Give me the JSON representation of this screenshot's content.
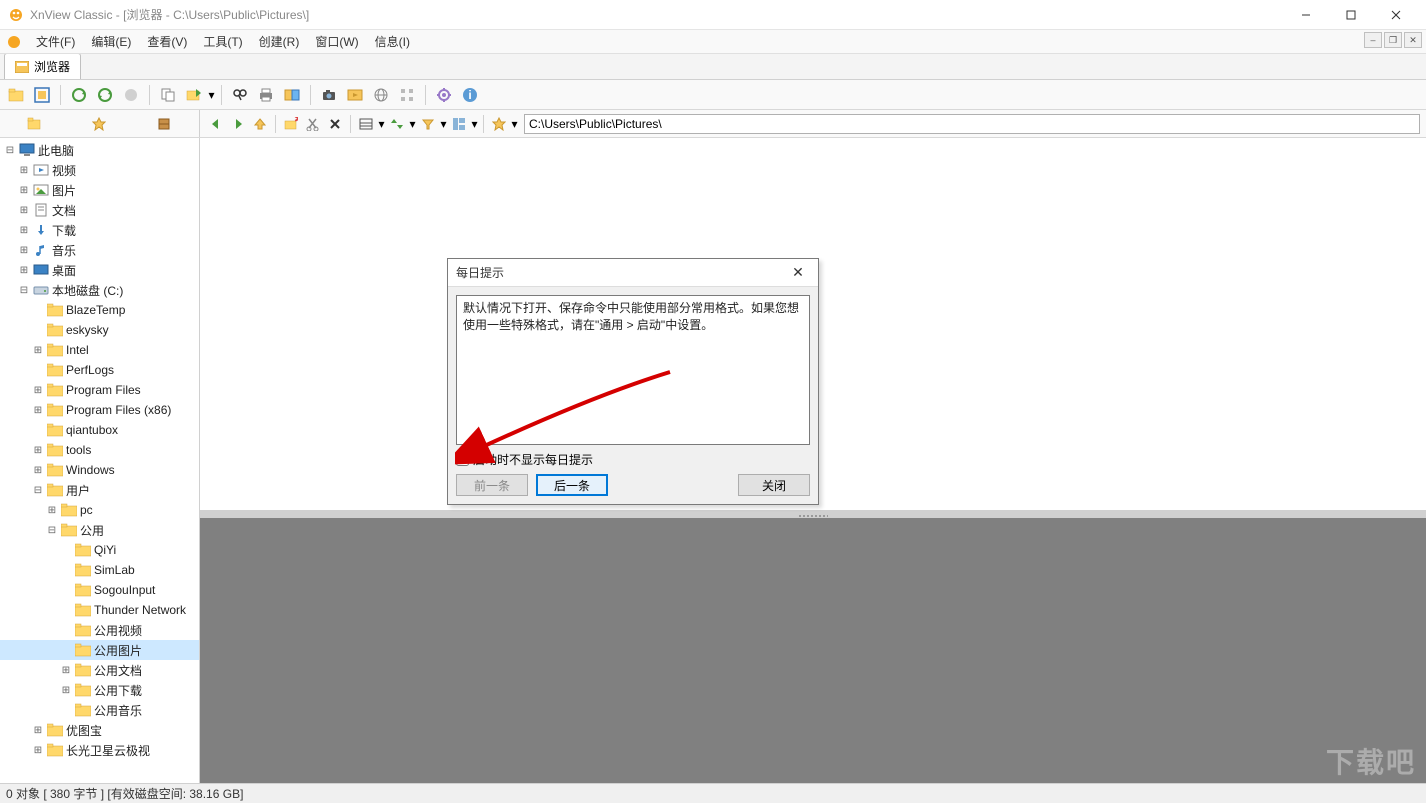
{
  "window": {
    "title": "XnView Classic - [浏览器 - C:\\Users\\Public\\Pictures\\]"
  },
  "menu": {
    "items": [
      "文件(F)",
      "编辑(E)",
      "查看(V)",
      "工具(T)",
      "创建(R)",
      "窗口(W)",
      "信息(I)"
    ]
  },
  "tab": {
    "label": "浏览器"
  },
  "address": {
    "path": "C:\\Users\\Public\\Pictures\\"
  },
  "tree": {
    "root": "此电脑",
    "libs": [
      "视频",
      "图片",
      "文档",
      "下载",
      "音乐",
      "桌面"
    ],
    "disk": "本地磁盘 (C:)",
    "folders_c": [
      "BlazeTemp",
      "eskysky",
      "Intel",
      "PerfLogs",
      "Program Files",
      "Program Files (x86)",
      "qiantubox",
      "tools",
      "Windows"
    ],
    "users": "用户",
    "user_children": [
      "pc",
      "公用"
    ],
    "gongyong_children": [
      "QiYi",
      "SimLab",
      "SogouInput",
      "Thunder Network",
      "公用视频",
      "公用图片",
      "公用文档",
      "公用下载",
      "公用音乐"
    ],
    "selected": "公用图片",
    "extra": [
      "优图宝",
      "长光卫星云极视"
    ]
  },
  "dialog": {
    "title": "每日提示",
    "tip": "默认情况下打开、保存命令中只能使用部分常用格式。如果您想使用一些特殊格式，请在\"通用 > 启动\"中设置。",
    "checkbox": "启动时不显示每日提示",
    "prev": "前一条",
    "next": "后一条",
    "close": "关闭"
  },
  "status": {
    "text": "0 对象 [ 380 字节 ] [有效磁盘空间: 38.16 GB]"
  },
  "watermark": "下载吧"
}
